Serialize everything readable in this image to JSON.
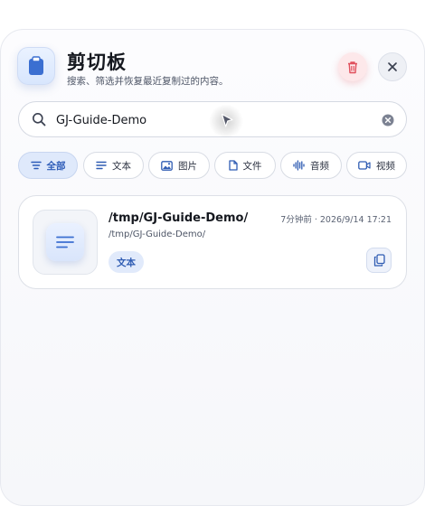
{
  "header": {
    "title": "剪切板",
    "subtitle": "搜索、筛选并恢复最近复制过的内容。",
    "app_icon": "clipboard-icon",
    "delete_icon": "trash-icon",
    "close_icon": "close-icon"
  },
  "search": {
    "value": "GJ-Guide-Demo",
    "icon": "search-icon",
    "clear_icon": "clear-icon"
  },
  "filters": [
    {
      "label": "全部",
      "icon": "list-icon",
      "active": true
    },
    {
      "label": "文本",
      "icon": "text-lines-icon",
      "active": false
    },
    {
      "label": "图片",
      "icon": "image-icon",
      "active": false
    },
    {
      "label": "文件",
      "icon": "file-icon",
      "active": false
    },
    {
      "label": "音频",
      "icon": "audio-wave-icon",
      "active": false
    },
    {
      "label": "视频",
      "icon": "video-icon",
      "active": false
    }
  ],
  "items": [
    {
      "title": "/tmp/GJ-Guide-Demo/",
      "path": "/tmp/GJ-Guide-Demo/",
      "time": "7分钟前 · 2026/9/14 17:21",
      "tag": "文本",
      "icon": "text-document-icon",
      "copy_icon": "copy-icon"
    }
  ],
  "colors": {
    "accent": "#2c5bb8",
    "danger": "#e0505d",
    "active_chip_bg": "#dfe9fb"
  }
}
